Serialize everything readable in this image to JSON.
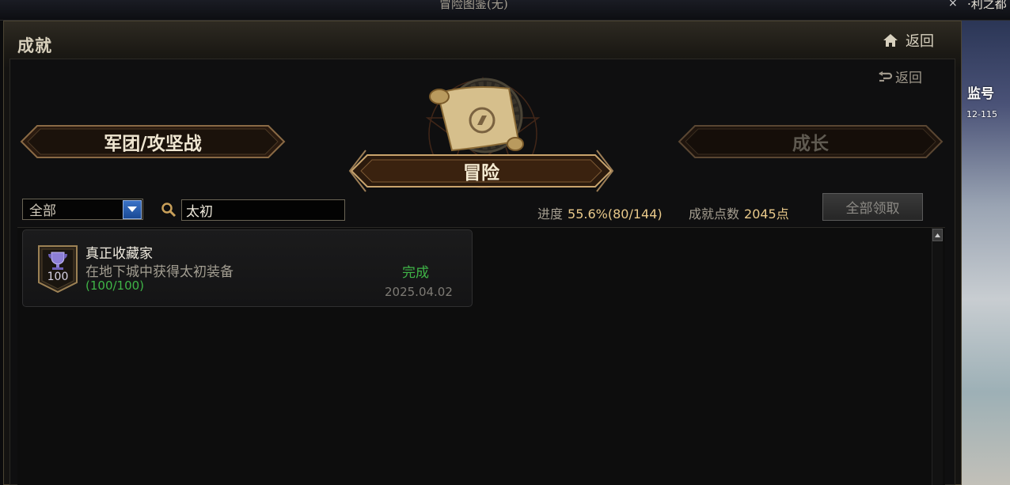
{
  "window": {
    "top_title": "冒险图鉴(无)",
    "right_partial_text": "·利之都",
    "close_glyph": "×"
  },
  "background": {
    "name_text": "监号",
    "level_text": "12-115"
  },
  "header": {
    "title": "成就",
    "home_label": "返回"
  },
  "panel": {
    "back_label": "返回"
  },
  "categories": {
    "left": "军团/攻坚战",
    "center": "冒险",
    "right": "成长"
  },
  "filters": {
    "select_value": "全部",
    "search_value": "太初"
  },
  "stats": {
    "progress_label": "进度",
    "progress_value": "55.6%(80/144)",
    "points_label": "成就点数",
    "points_value": "2045点",
    "claim_all_label": "全部领取"
  },
  "achievements": [
    {
      "badge_points": "100",
      "title": "真正收藏家",
      "description": "在地下城中获得太初装备",
      "count": "(100/100)",
      "status": "完成",
      "date": "2025.04.02"
    }
  ],
  "colors": {
    "gold_value": "#e9c98a",
    "complete_green": "#3fb447"
  }
}
